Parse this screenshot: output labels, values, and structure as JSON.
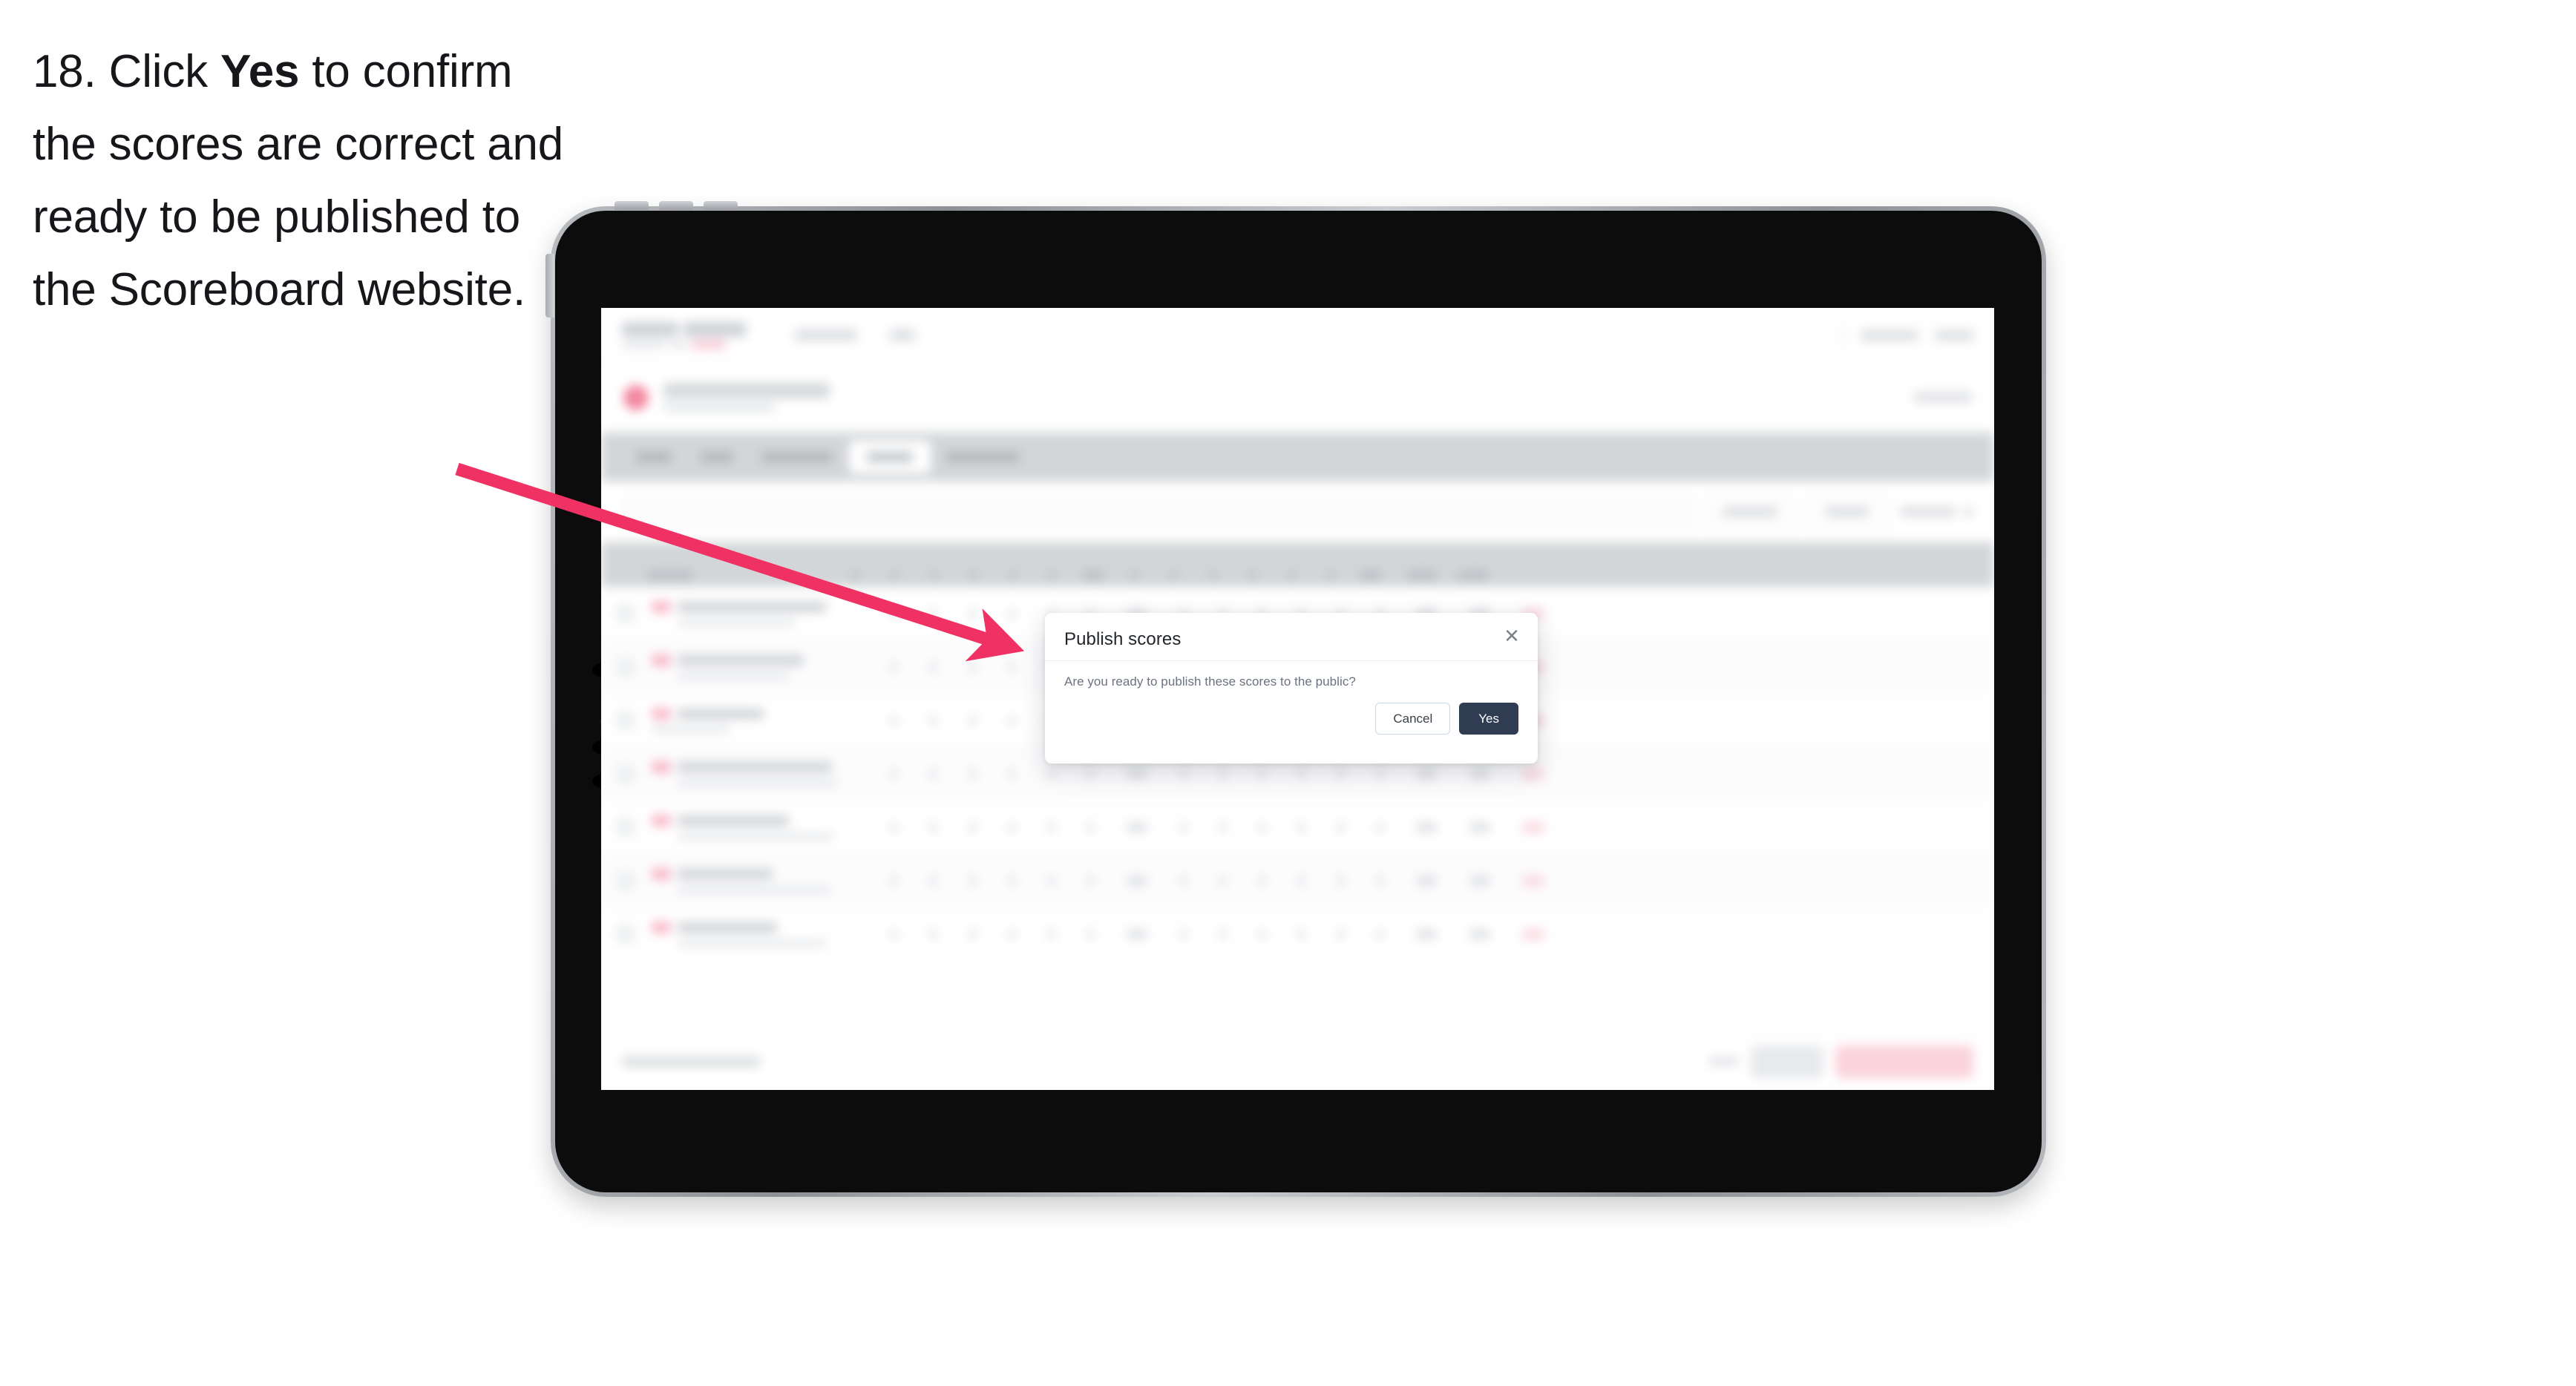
{
  "instruction": {
    "step_number": "18.",
    "text_before": "Click",
    "emphasis": "Yes",
    "text_after": "to confirm the scores are correct and ready to be published to the Scoreboard website."
  },
  "modal": {
    "title": "Publish scores",
    "message": "Are you ready to publish these scores to the public?",
    "close_icon": "✕",
    "cancel_label": "Cancel",
    "yes_label": "Yes"
  },
  "colors": {
    "arrow": "#EF3163",
    "yes_button": "#2F3C52",
    "cancel_border": "#C8D6EE",
    "device_body": "#0C0C0D",
    "device_metal": "#A9ACB1",
    "tab_bar": "#D3D6D9",
    "brand_pink": "#F2889F"
  },
  "device": {
    "type": "tablet",
    "orientation": "landscape"
  }
}
